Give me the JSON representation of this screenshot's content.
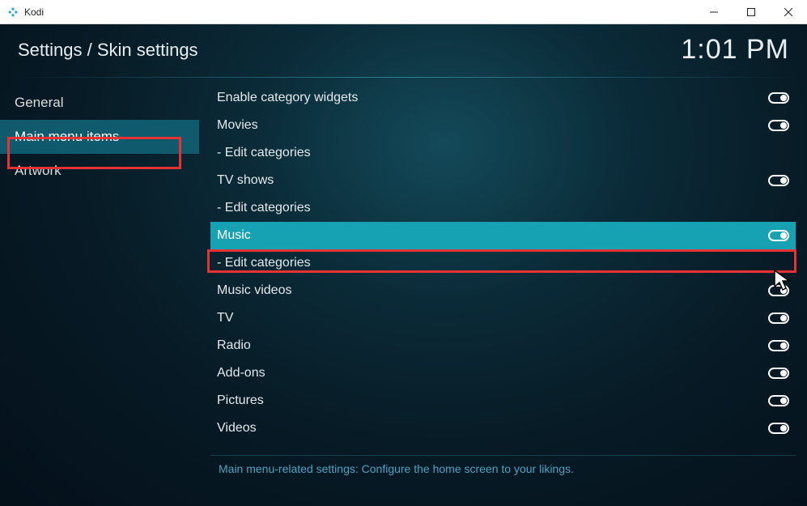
{
  "window": {
    "title": "Kodi"
  },
  "header": {
    "breadcrumb": "Settings / Skin settings",
    "clock": "1:01 PM"
  },
  "sidebar": {
    "items": [
      {
        "label": "General",
        "selected": false
      },
      {
        "label": "Main menu items",
        "selected": true
      },
      {
        "label": "Artwork",
        "selected": false
      }
    ]
  },
  "settings": [
    {
      "label": "Enable category widgets",
      "toggle": true,
      "highlighted": false
    },
    {
      "label": "Movies",
      "toggle": true,
      "highlighted": false
    },
    {
      "label": "- Edit categories",
      "toggle": false,
      "highlighted": false
    },
    {
      "label": "TV shows",
      "toggle": true,
      "highlighted": false
    },
    {
      "label": "- Edit categories",
      "toggle": false,
      "highlighted": false
    },
    {
      "label": "Music",
      "toggle": true,
      "highlighted": true
    },
    {
      "label": "- Edit categories",
      "toggle": false,
      "highlighted": false
    },
    {
      "label": "Music videos",
      "toggle": true,
      "highlighted": false
    },
    {
      "label": "TV",
      "toggle": true,
      "highlighted": false
    },
    {
      "label": "Radio",
      "toggle": true,
      "highlighted": false
    },
    {
      "label": "Add-ons",
      "toggle": true,
      "highlighted": false
    },
    {
      "label": "Pictures",
      "toggle": true,
      "highlighted": false
    },
    {
      "label": "Videos",
      "toggle": true,
      "highlighted": false
    }
  ],
  "footer": {
    "help_text": "Main menu-related settings: Configure the home screen to your likings."
  },
  "colors": {
    "accent": "#17a2b3",
    "highlight_border": "#e63232"
  }
}
